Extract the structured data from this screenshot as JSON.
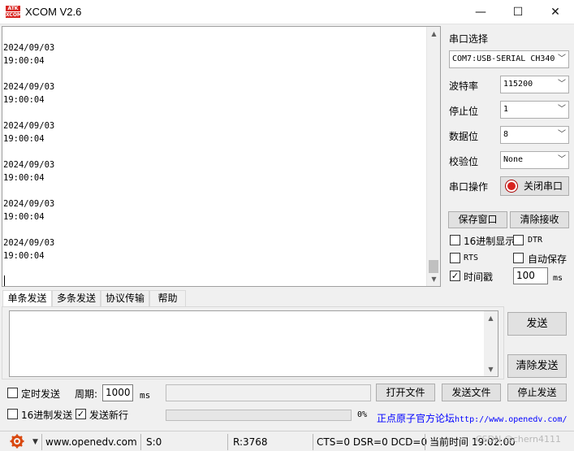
{
  "window": {
    "title": "XCOM V2.6",
    "icon_line1": "ATK",
    "icon_line2": "XCOM",
    "minimize": "—",
    "maximize": "☐",
    "close": "✕"
  },
  "receive": {
    "lines": [
      "2024/09/03",
      "19:00:04",
      "2024/09/03",
      "19:00:04",
      "2024/09/03",
      "19:00:04",
      "2024/09/03",
      "19:00:04",
      "2024/09/03",
      "19:00:04",
      "2024/09/03",
      "19:00:04"
    ]
  },
  "serial": {
    "port_label": "串口选择",
    "port_value": "COM7:USB-SERIAL CH340",
    "baud_label": "波特率",
    "baud_value": "115200",
    "stop_label": "停止位",
    "stop_value": "1",
    "data_label": "数据位",
    "data_value": "8",
    "parity_label": "校验位",
    "parity_value": "None",
    "op_label": "串口操作",
    "op_button": "关闭串口"
  },
  "right_buttons": {
    "save_window": "保存窗口",
    "clear_recv": "清除接收"
  },
  "options": {
    "hex_display": "16进制显示",
    "dtr": "DTR",
    "rts": "RTS",
    "auto_save": "自动保存",
    "timestamp": "时间戳",
    "timestamp_value": "100",
    "ms": "ms"
  },
  "tabs": [
    "单条发送",
    "多条发送",
    "协议传输",
    "帮助"
  ],
  "send": {
    "send_button": "发送",
    "clear_send": "清除发送",
    "timed_send": "定时发送",
    "period_label": "周期:",
    "period_value": "1000",
    "period_unit": "ms",
    "open_file": "打开文件",
    "send_file": "发送文件",
    "stop_send": "停止发送",
    "hex_send": "16进制发送",
    "send_newline": "发送新行",
    "progress_text": "0%",
    "forum_text": "正点原子官方论坛",
    "forum_url": "http://www.openedv.com/"
  },
  "status": {
    "website": "www.openedv.com",
    "sent": "S:0",
    "received": "R:3768",
    "lines": "CTS=0 DSR=0 DCD=0",
    "time_label": "当前时间 19:02:00",
    "watermark": "CSDN @chern4111"
  },
  "colors": {
    "accent_red": "#d8231f",
    "link_blue": "#0000ff"
  }
}
